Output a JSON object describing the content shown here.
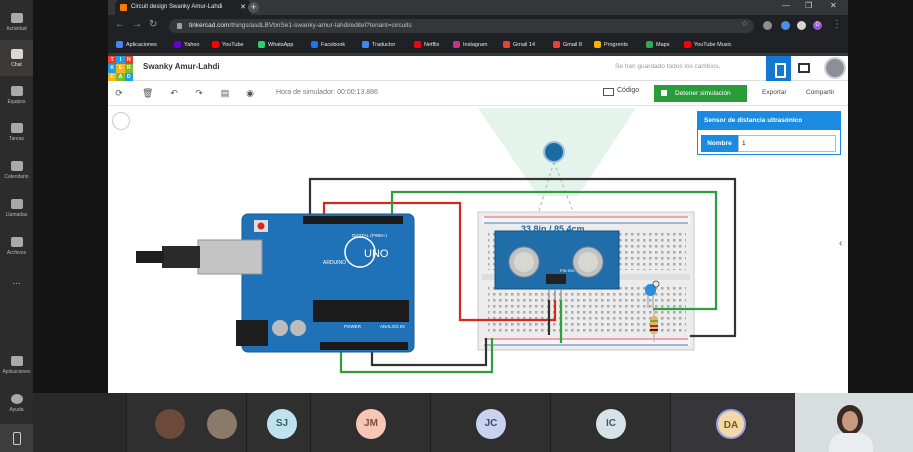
{
  "teams_rail": {
    "items": [
      {
        "label": "Actividad",
        "icon": "bell-icon"
      },
      {
        "label": "Chat",
        "icon": "chat-icon"
      },
      {
        "label": "Equipos",
        "icon": "teams-icon"
      },
      {
        "label": "Tareas",
        "icon": "assignments-icon"
      },
      {
        "label": "Calendario",
        "icon": "calendar-icon"
      },
      {
        "label": "Llamadas",
        "icon": "phone-icon"
      },
      {
        "label": "Archivos",
        "icon": "files-icon"
      },
      {
        "label": "...",
        "icon": "more-icon"
      },
      {
        "label": "Aplicaciones",
        "icon": "apps-icon"
      },
      {
        "label": "Ayuda",
        "icon": "help-icon"
      }
    ]
  },
  "browser": {
    "tab_title": "Circuit design Swanky Amur-Lahdi",
    "url_host": "tinkercad.com",
    "url_path": "/things/asdLBVbnSe1-swanky-amur-lahdi/editel?tenant=circuits",
    "profile_initial": "D",
    "bookmarks": [
      {
        "label": "Aplicaciones",
        "color": "#4285f4"
      },
      {
        "label": "Yahoo",
        "color": "#6001d2"
      },
      {
        "label": "YouTube",
        "color": "#ff0000"
      },
      {
        "label": "WhatsApp",
        "color": "#25d366"
      },
      {
        "label": "Facebook",
        "color": "#1877f2"
      },
      {
        "label": "Traductor",
        "color": "#4285f4"
      },
      {
        "label": "Netflix",
        "color": "#e50914"
      },
      {
        "label": "Instagram",
        "color": "#c13584"
      },
      {
        "label": "Gmail 14",
        "color": "#ea4335"
      },
      {
        "label": "Gmail 8",
        "color": "#ea4335"
      },
      {
        "label": "Progrents",
        "color": "#f4b400"
      },
      {
        "label": "Maps",
        "color": "#34a853"
      },
      {
        "label": "YouTube Music",
        "color": "#ff0000"
      }
    ]
  },
  "tinkercad": {
    "logo_letters": [
      "TIN",
      "KER",
      "CAD"
    ],
    "project_title": "Swanky Amur-Lahdi",
    "save_status": "Se han guardado todos los cambios.",
    "sim_time": "Hora de simulador: 00:00:13.886",
    "code_label": "Código",
    "stop_label": "Detener simulación",
    "export_label": "Exportar",
    "share_label": "Compartir",
    "sensor_readout": "33.8in / 85.4cm",
    "props_title": "Sensor de distancia ultrasónico",
    "props_name_label": "Nombre",
    "props_name_value": "1",
    "board_labels": {
      "brand": "UNO",
      "arduino": "ARDUINO",
      "digital": "DIGITAL (PWM~)",
      "power": "POWER",
      "analog": "ANALOG IN",
      "sensor_pins": "PIN SIG"
    }
  },
  "participants": [
    {
      "initials": "",
      "kind": "photo"
    },
    {
      "initials": "",
      "kind": "photo"
    },
    {
      "initials": "SJ",
      "color": "#bfe3ee",
      "text": "#3b5b66"
    },
    {
      "initials": "JM",
      "color": "#f7c6b5",
      "text": "#8a4a37"
    },
    {
      "initials": "JC",
      "color": "#c8d3f0",
      "text": "#3b4a78"
    },
    {
      "initials": "IC",
      "color": "#d6e4ea",
      "text": "#445a63"
    },
    {
      "initials": "DA",
      "color": "#f4d9a8",
      "text": "#7a5418"
    }
  ]
}
